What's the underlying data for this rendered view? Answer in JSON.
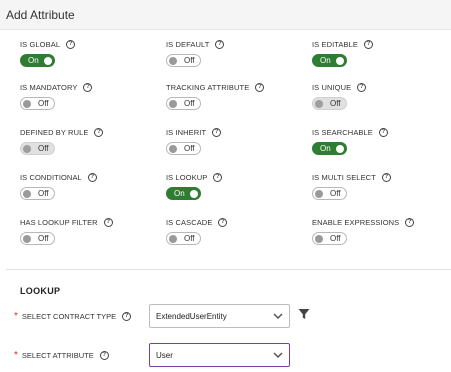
{
  "header": {
    "title": "Add Attribute"
  },
  "attributes": [
    {
      "label": "IS GLOBAL",
      "state": "On",
      "on": true,
      "disabled": false
    },
    {
      "label": "IS DEFAULT",
      "state": "Off",
      "on": false,
      "disabled": false
    },
    {
      "label": "IS EDITABLE",
      "state": "On",
      "on": true,
      "disabled": false
    },
    {
      "label": "IS MANDATORY",
      "state": "Off",
      "on": false,
      "disabled": false
    },
    {
      "label": "TRACKING ATTRIBUTE",
      "state": "Off",
      "on": false,
      "disabled": false
    },
    {
      "label": "IS UNIQUE",
      "state": "Off",
      "on": false,
      "disabled": true
    },
    {
      "label": "DEFINED BY RULE",
      "state": "Off",
      "on": false,
      "disabled": true
    },
    {
      "label": "IS INHERIT",
      "state": "Off",
      "on": false,
      "disabled": false
    },
    {
      "label": "IS SEARCHABLE",
      "state": "On",
      "on": true,
      "disabled": false
    },
    {
      "label": "IS CONDITIONAL",
      "state": "Off",
      "on": false,
      "disabled": false
    },
    {
      "label": "IS LOOKUP",
      "state": "On",
      "on": true,
      "disabled": false
    },
    {
      "label": "IS MULTI SELECT",
      "state": "Off",
      "on": false,
      "disabled": false
    },
    {
      "label": "HAS LOOKUP FILTER",
      "state": "Off",
      "on": false,
      "disabled": false
    },
    {
      "label": "IS CASCADE",
      "state": "Off",
      "on": false,
      "disabled": false
    },
    {
      "label": "ENABLE EXPRESSIONS",
      "state": "Off",
      "on": false,
      "disabled": false
    }
  ],
  "lookup": {
    "title": "LOOKUP",
    "contract_type": {
      "label": "SELECT CONTRACT TYPE",
      "value": "ExtendedUserEntity"
    },
    "attribute": {
      "label": "SELECT ATTRIBUTE",
      "value": "User"
    }
  },
  "icons": {
    "help": "help-circle-icon",
    "filter": "filter-icon",
    "dropdown": "chevron-down-icon"
  },
  "colors": {
    "toggle_on": "#2e7d32",
    "required": "#d32f2f",
    "focus_border": "#7b3fa3"
  }
}
